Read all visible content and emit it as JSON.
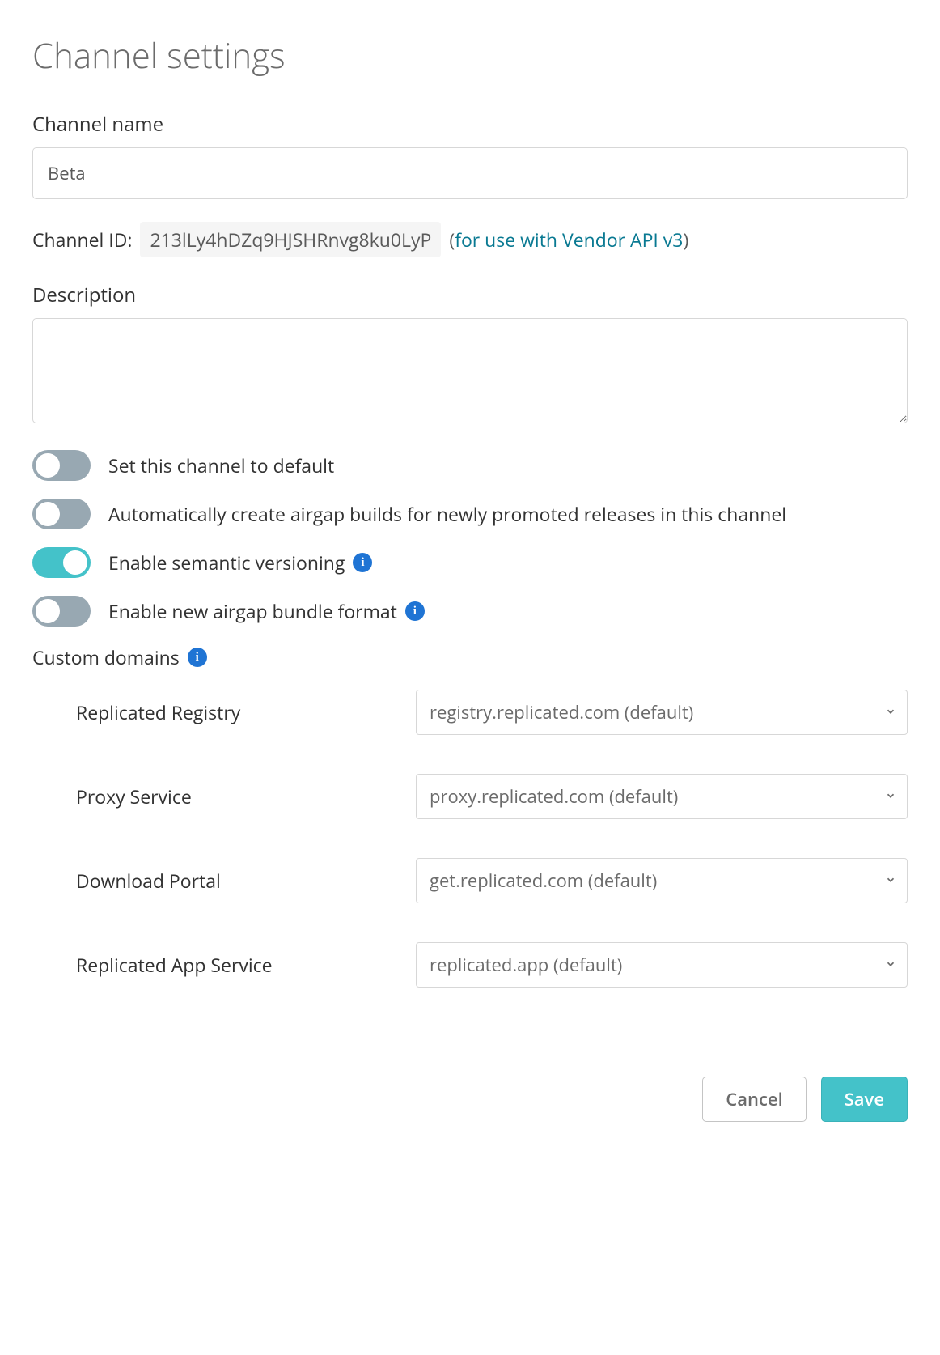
{
  "title": "Channel settings",
  "channel_name": {
    "label": "Channel name",
    "value": "Beta"
  },
  "channel_id": {
    "label": "Channel ID:",
    "value": "213lLy4hDZq9HJSHRnvg8ku0LyP",
    "hint_prefix": "(",
    "hint_link": "for use with Vendor API v3",
    "hint_suffix": ")"
  },
  "description": {
    "label": "Description",
    "value": ""
  },
  "toggles": {
    "default_channel": {
      "on": false,
      "label": "Set this channel to default"
    },
    "airgap_builds": {
      "on": false,
      "label": "Automatically create airgap builds for newly promoted releases in this channel"
    },
    "semver": {
      "on": true,
      "label": "Enable semantic versioning"
    },
    "new_airgap_format": {
      "on": false,
      "label": "Enable new airgap bundle format"
    }
  },
  "custom_domains": {
    "label": "Custom domains",
    "items": [
      {
        "label": "Replicated Registry",
        "value": "registry.replicated.com (default)"
      },
      {
        "label": "Proxy Service",
        "value": "proxy.replicated.com (default)"
      },
      {
        "label": "Download Portal",
        "value": "get.replicated.com (default)"
      },
      {
        "label": "Replicated App Service",
        "value": "replicated.app (default)"
      }
    ]
  },
  "buttons": {
    "cancel": "Cancel",
    "save": "Save"
  }
}
